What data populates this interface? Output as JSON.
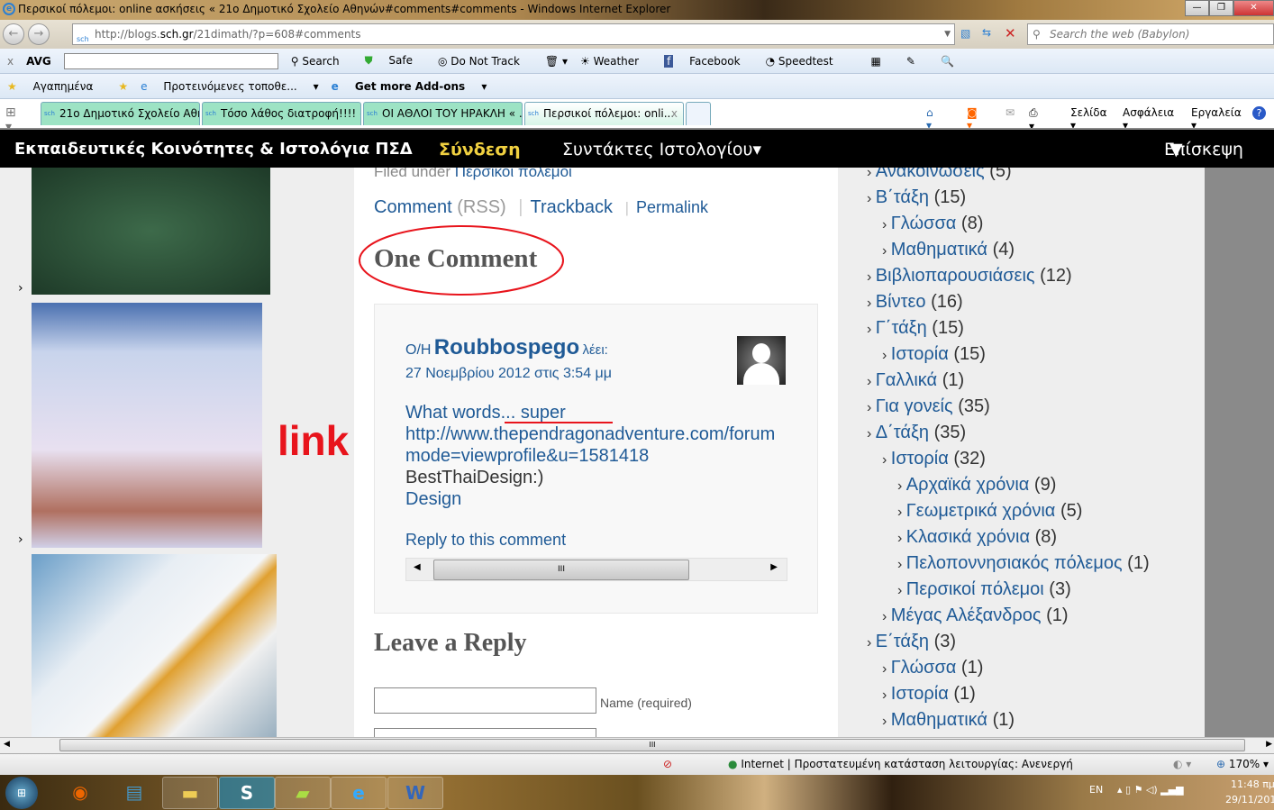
{
  "window": {
    "title": "Περσικοί πόλεμοι: online ασκήσεις « 21ο Δημοτικό Σχολείο Αθηνών#comments#comments - Windows Internet Explorer"
  },
  "address": {
    "prefix": "http://blogs.",
    "domain": "sch.gr",
    "path": "/21dimath/?p=608#comments",
    "search_placeholder": "Search the web (Babylon)"
  },
  "avg_toolbar": {
    "brand": "AVG",
    "items": [
      "Search",
      "Safe",
      "Do Not Track",
      "Weather",
      "Facebook",
      "Speedtest"
    ]
  },
  "fav_toolbar": {
    "favorites": "Αγαπημένα",
    "suggested": "Προτεινόμενες τοποθε...",
    "addons": "Get more Add-ons"
  },
  "tabs": [
    "21ο Δημοτικό Σχολείο Αθη...",
    "Τόσο λάθος διατροφή!!!! «...",
    "ΟΙ ΑΘΛΟΙ ΤΟΥ ΗΡΑΚΛΗ « ...",
    "Περσικοί πόλεμοι: onli..."
  ],
  "tab_favicon": "sch",
  "command_bar": [
    "Σελίδα",
    "Ασφάλεια",
    "Εργαλεία"
  ],
  "site_nav": {
    "title": "Εκπαιδευτικές Κοινότητες & Ιστολόγια ΠΣΔ",
    "login": "Σύνδεση",
    "authors": "Συντάκτες Ιστολογίου▾",
    "visit": "Επίσκεψη"
  },
  "post": {
    "filed_label": "Filed under",
    "filed_cat": "Περσικοί πόλεμοι",
    "comment": "Comment",
    "rss": "(RSS)",
    "trackback": "Trackback",
    "permalink": "Permalink",
    "sep": "|"
  },
  "comments": {
    "heading": "One Comment",
    "author_prefix": "Ο/Η",
    "author": "Roubbospego",
    "says": "λέει:",
    "date": "27 Νοεμβρίου 2012 στις 3:54 μμ",
    "line1": "What words... super",
    "line2": "http://www.thependragonadventure.com/forum",
    "line3": "mode=viewprofile&u=1581418",
    "line4": "BestThaiDesign:)",
    "line5": "Design",
    "reply": "Reply to this comment"
  },
  "annotation": {
    "label": "link",
    "color": "#e8141c"
  },
  "reply_form": {
    "heading": "Leave a Reply",
    "name_label": "Name (required)"
  },
  "sidebar": [
    {
      "label": "Ανακοινώσεις",
      "count": "(5)",
      "level": 0
    },
    {
      "label": "Β΄τάξη",
      "count": "(15)",
      "level": 0
    },
    {
      "label": "Γλώσσα",
      "count": "(8)",
      "level": 1
    },
    {
      "label": "Μαθηματικά",
      "count": "(4)",
      "level": 1
    },
    {
      "label": "Βιβλιοπαρουσιάσεις",
      "count": "(12)",
      "level": 0
    },
    {
      "label": "Βίντεο",
      "count": "(16)",
      "level": 0
    },
    {
      "label": "Γ΄τάξη",
      "count": "(15)",
      "level": 0
    },
    {
      "label": "Ιστορία",
      "count": "(15)",
      "level": 1
    },
    {
      "label": "Γαλλικά",
      "count": "(1)",
      "level": 0
    },
    {
      "label": "Για γονείς",
      "count": "(35)",
      "level": 0
    },
    {
      "label": "Δ΄τάξη",
      "count": "(35)",
      "level": 0
    },
    {
      "label": "Ιστορία",
      "count": "(32)",
      "level": 1
    },
    {
      "label": "Αρχαϊκά χρόνια",
      "count": "(9)",
      "level": 2
    },
    {
      "label": "Γεωμετρικά χρόνια",
      "count": "(5)",
      "level": 2
    },
    {
      "label": "Κλασικά χρόνια",
      "count": "(8)",
      "level": 2
    },
    {
      "label": "Πελοποννησιακός πόλεμος",
      "count": "(1)",
      "level": 2
    },
    {
      "label": "Περσικοί πόλεμοι",
      "count": "(3)",
      "level": 2
    },
    {
      "label": "Μέγας Αλέξανδρος",
      "count": "(1)",
      "level": 1
    },
    {
      "label": "Ε΄τάξη",
      "count": "(3)",
      "level": 0
    },
    {
      "label": "Γλώσσα",
      "count": "(1)",
      "level": 1
    },
    {
      "label": "Ιστορία",
      "count": "(1)",
      "level": 1
    },
    {
      "label": "Μαθηματικά",
      "count": "(1)",
      "level": 1
    }
  ],
  "status": {
    "zone": "Internet | Προστατευμένη κατάσταση λειτουργίας: Ανενεργή",
    "zoom": "170%"
  },
  "taskbar": {
    "lang": "EN",
    "time": "11:48 πμ",
    "date": "29/11/201"
  }
}
